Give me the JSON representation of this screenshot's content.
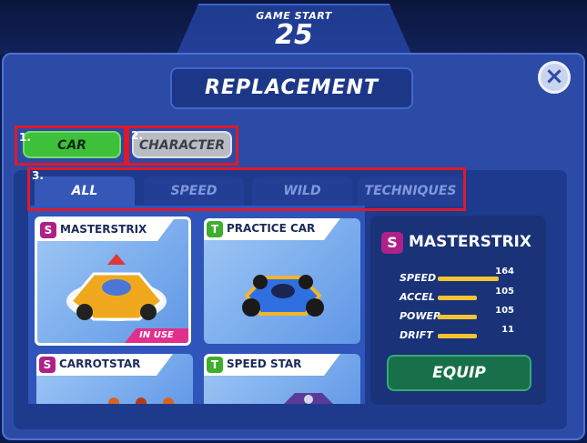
{
  "header": {
    "label": "GAME START",
    "countdown": "25"
  },
  "title": "REPLACEMENT",
  "categories": {
    "car": "CAR",
    "character": "CHARACTER"
  },
  "markers": [
    "1.",
    "2.",
    "3."
  ],
  "tabs": [
    "ALL",
    "SPEED",
    "WILD",
    "TECHNIQUES"
  ],
  "cards": [
    {
      "badge": "S",
      "name": "MASTERSTRIX",
      "status": "IN USE"
    },
    {
      "badge": "T",
      "name": "PRACTICE CAR"
    },
    {
      "badge": "S",
      "name": "CARROTSTAR"
    },
    {
      "badge": "T",
      "name": "SPEED STAR"
    }
  ],
  "detail": {
    "badge": "S",
    "name": "MASTERSTRIX",
    "stats": [
      {
        "label": "SPEED",
        "value": "164",
        "fill": 0.82
      },
      {
        "label": "ACCEL",
        "value": "105",
        "fill": 0.53
      },
      {
        "label": "POWER",
        "value": "105",
        "fill": 0.53
      },
      {
        "label": "DRIFT",
        "value": "11",
        "fill": 0.53
      }
    ],
    "equip_label": "EQUIP"
  },
  "colors": {
    "panel": "#2b4ba6",
    "accent_green": "#3ec03a",
    "marker_red": "#e0182b",
    "badge_s": "#b0208a",
    "badge_t": "#3fae2e"
  },
  "icons": {
    "close": "close-icon"
  }
}
